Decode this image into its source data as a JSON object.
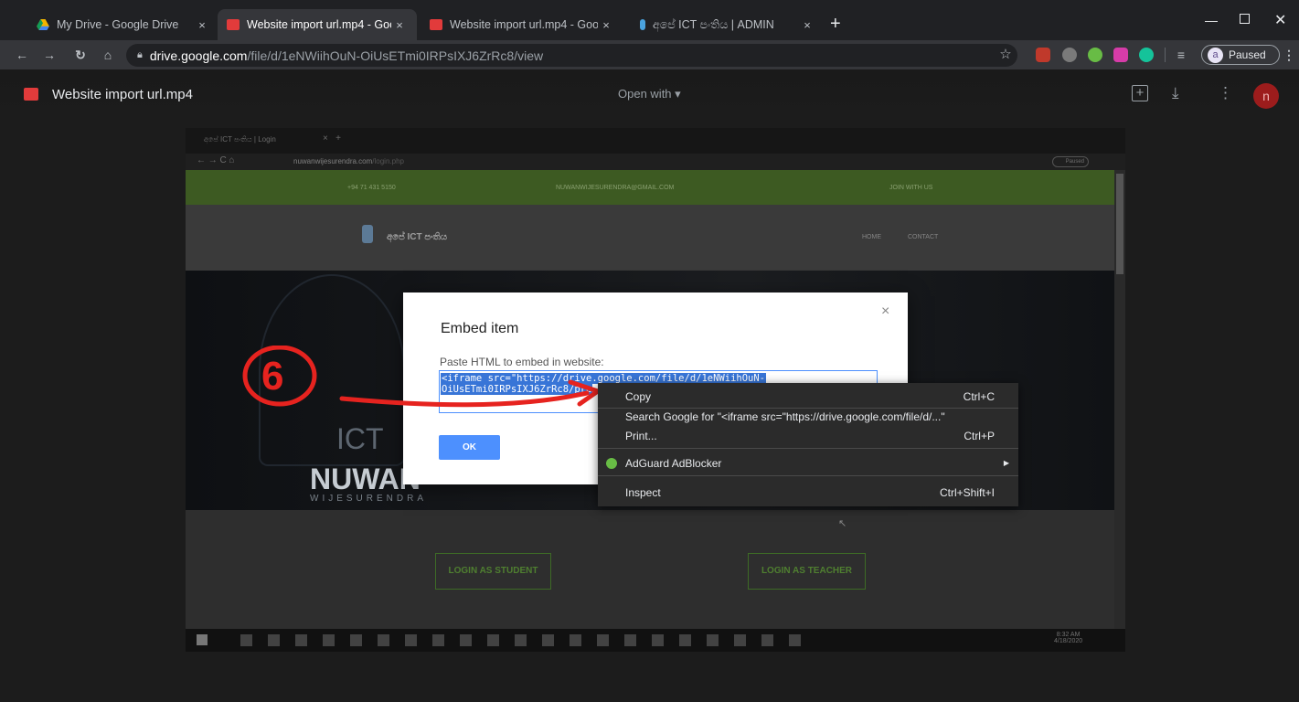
{
  "tabs": [
    {
      "title": "My Drive - Google Drive",
      "fav": "#f4b400"
    },
    {
      "title": "Website import url.mp4 - Google",
      "fav": "#e23b3b"
    },
    {
      "title": "Website import url.mp4 - Google",
      "fav": "#e23b3b"
    },
    {
      "title": "අපේ ICT පංතිය | ADMIN",
      "fav": "#4aa3df"
    }
  ],
  "new_tab": "+",
  "address": {
    "domain": "drive.google.com",
    "path": "/file/d/1eNWiihOuN-OiUsETmi0IRPsIXJ6ZrRc8/view"
  },
  "profile": {
    "initial": "a",
    "status": "Paused"
  },
  "viewer": {
    "file_title": "Website import url.mp4",
    "open_with": "Open with",
    "avatar": "n"
  },
  "inner": {
    "tab": "අපේ ICT පංතිය | Login",
    "url_domain": "nuwanwijesurendra.com",
    "url_path": "/login.php",
    "phone": "+94 71 431 5150",
    "email": "NUWANWIJESURENDRA@GMAIL.COM",
    "join": "JOIN WITH US",
    "brand": "අපේ ICT පංතිය",
    "nav_home": "HOME",
    "nav_contact": "CONTACT",
    "logo_ict": "ICT",
    "logo_name": "NUWAN",
    "logo_sub": "WIJESURENDRA",
    "login_student": "LOGIN AS STUDENT",
    "login_teacher": "LOGIN AS TEACHER",
    "clock_time": "8:32 AM",
    "clock_date": "4/18/2020",
    "profile_status": "Paused"
  },
  "annotation": {
    "step": "6"
  },
  "modal": {
    "title": "Embed item",
    "label": "Paste HTML to embed in website:",
    "code_line1": "<iframe src=\"https://drive.google.com/file/d/1eNWiihOuN-",
    "code_line2": "OiUsETmi0IRPsIXJ6ZrRc8/pre",
    "ok": "OK",
    "close": "×"
  },
  "context_menu": {
    "copy": "Copy",
    "copy_sc": "Ctrl+C",
    "search": "Search Google for \"<iframe src=\"https://drive.google.com/file/d/...\"",
    "print": "Print...",
    "print_sc": "Ctrl+P",
    "adguard": "AdGuard AdBlocker",
    "inspect": "Inspect",
    "inspect_sc": "Ctrl+Shift+I"
  },
  "colors": {
    "accent": "#4d90fe",
    "annotation": "#e6231f",
    "inner_green": "#6b9b3a",
    "selection": "#3875d7"
  }
}
